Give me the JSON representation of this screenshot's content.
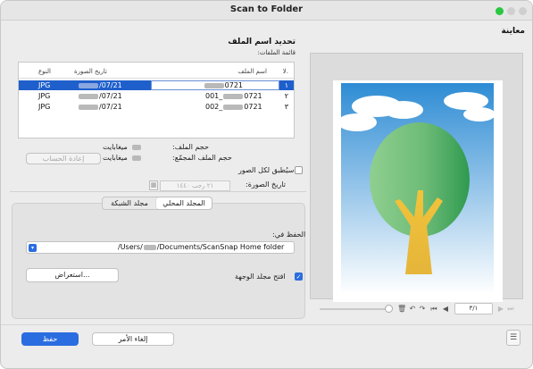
{
  "window": {
    "title": "Scan to Folder"
  },
  "preview": {
    "label": "معاينة"
  },
  "navigation": {
    "page_display": "٣/١"
  },
  "rename": {
    "title": "تحديد اسم الملف",
    "file_list_label": "قائمة الملفات:",
    "columns": {
      "no": "لا.",
      "filename": "اسم الملف",
      "image_date": "تاريخ الصورة",
      "type": "النوع"
    },
    "rows": [
      {
        "no": "١",
        "name_suffix": "0721",
        "date_suffix": "/07/21",
        "type": "JPG"
      },
      {
        "no": "٢",
        "name_prefix": "001_",
        "name_suffix": "0721",
        "date_suffix": "/07/21",
        "type": "JPG"
      },
      {
        "no": "٣",
        "name_prefix": "002_",
        "name_suffix": "0721",
        "date_suffix": "/07/21",
        "type": "JPG"
      }
    ],
    "file_size_label": "حجم الملف:",
    "file_size_unit": "ميغابايت",
    "total_size_label": "حجم الملف المجمّع:",
    "total_size_unit": "ميغابايت",
    "recalc_button": "إعادة الحساب",
    "apply_all_label": "سيُطبق لكل الصور",
    "image_date_label": "تاريخ الصورة:",
    "date_value": "٢١ رجب ١٤٤٠"
  },
  "save": {
    "tab_local": "المجلد المحلي",
    "tab_network": "مجلد الشبكة",
    "save_in_label": "الحفظ في:",
    "path_prefix": "/Users/",
    "path_suffix": "/Documents/ScanSnap Home folder",
    "browse_button": "استعراض...",
    "open_folder_label": "افتح مجلد الوجهة"
  },
  "footer": {
    "save_button": "حفظ",
    "cancel_button": "إلغاء الأمر"
  },
  "colors": {
    "accent": "#2a6de0",
    "selection": "#1f5fcc"
  }
}
